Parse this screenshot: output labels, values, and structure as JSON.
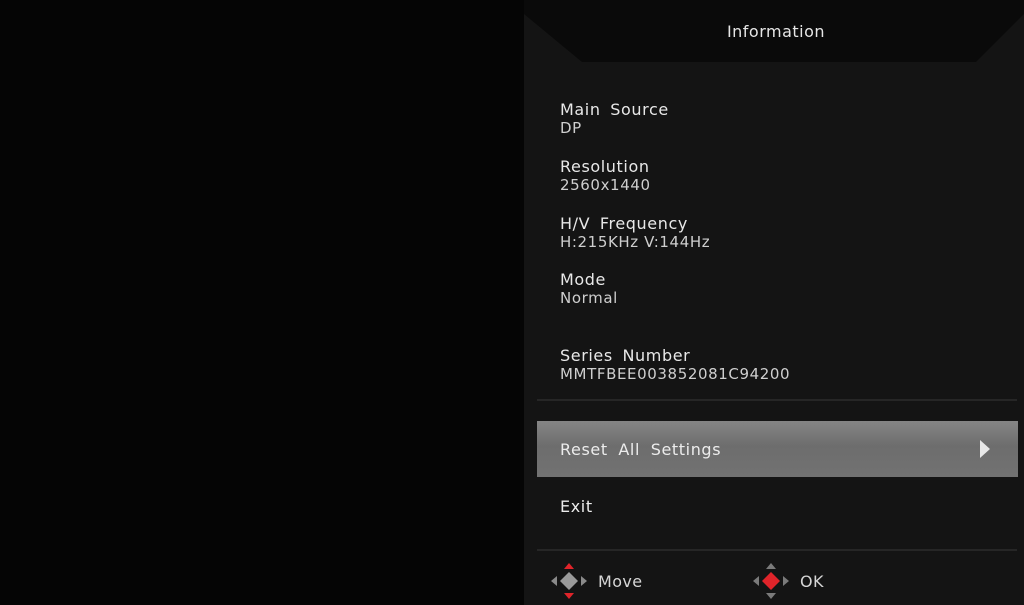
{
  "osd": {
    "title": "Information",
    "info": [
      {
        "label": "Main Source",
        "value": "DP"
      },
      {
        "label": "Resolution",
        "value": "2560x1440"
      },
      {
        "label": "H/V Frequency",
        "value": "H:215KHz V:144Hz"
      },
      {
        "label": "Mode",
        "value": "Normal"
      },
      {
        "label": "Series Number",
        "value": "MMTFBEE003852081C94200"
      }
    ],
    "menu": {
      "reset_label": "Reset All Settings",
      "exit_label": "Exit"
    },
    "footer": {
      "move_label": "Move",
      "ok_label": "OK"
    }
  },
  "icons": {
    "selected_arrow": "arrow-right-icon",
    "move": "dpad-move-icon",
    "ok": "dpad-ok-icon"
  },
  "colors": {
    "panel_bg": "#141414",
    "header_bg": "#0a0a0a",
    "selected_bg": "#7a7a7a",
    "accent_red": "#e0242a",
    "text": "#e8e8e8"
  }
}
